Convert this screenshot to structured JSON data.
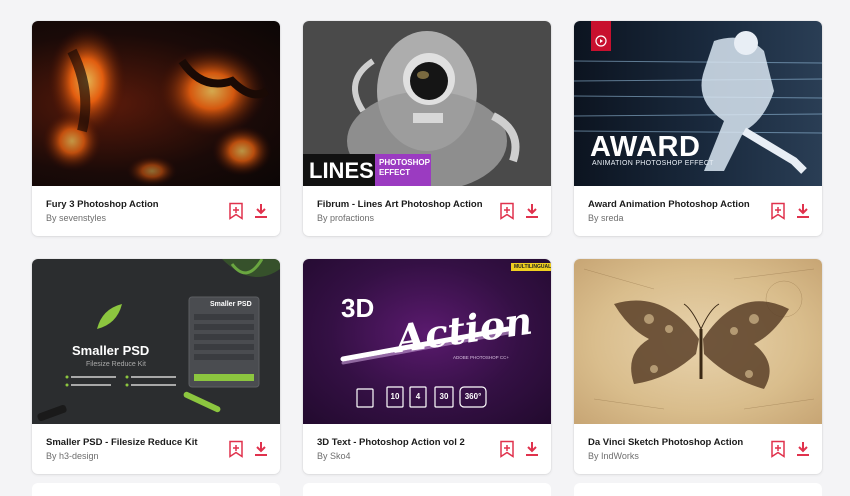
{
  "accent_color": "#e0324d",
  "cards": [
    {
      "title": "Fury 3 Photoshop Action",
      "author": "By sevenstyles",
      "bookmark_icon": "bookmark-add-icon",
      "download_icon": "download-icon"
    },
    {
      "title": "Fibrum - Lines Art Photoshop Action",
      "author": "By profactions",
      "bookmark_icon": "bookmark-add-icon",
      "download_icon": "download-icon",
      "thumb_text": {
        "big": "LINES",
        "tag_line1": "PHOTOSHOP",
        "tag_line2": "EFFECT"
      }
    },
    {
      "title": "Award Animation Photoshop Action",
      "author": "By sreda",
      "bookmark_icon": "bookmark-add-icon",
      "download_icon": "download-icon",
      "thumb_text": {
        "big": "AWARD",
        "sub": "ANIMATION PHOTOSHOP EFFECT"
      }
    },
    {
      "title": "Smaller PSD - Filesize Reduce Kit",
      "author": "By h3-design",
      "bookmark_icon": "bookmark-add-icon",
      "download_icon": "download-icon",
      "thumb_text": {
        "big": "Smaller PSD",
        "sub": "Filesize Reduce Kit",
        "panel_title": "Smaller PSD"
      }
    },
    {
      "title": "3D Text - Photoshop Action vol 2",
      "author": "By Sko4",
      "bookmark_icon": "bookmark-add-icon",
      "download_icon": "download-icon",
      "thumb_text": {
        "big": "3D",
        "script": "Action",
        "badge": "MULTILINGUAL",
        "sub": "ADOBE PHOTOSHOP CC+",
        "n1": "10",
        "n2": "4",
        "n3": "30",
        "n4": "360°"
      }
    },
    {
      "title": "Da Vinci Sketch Photoshop Action",
      "author": "By IndWorks",
      "bookmark_icon": "bookmark-add-icon",
      "download_icon": "download-icon"
    }
  ]
}
